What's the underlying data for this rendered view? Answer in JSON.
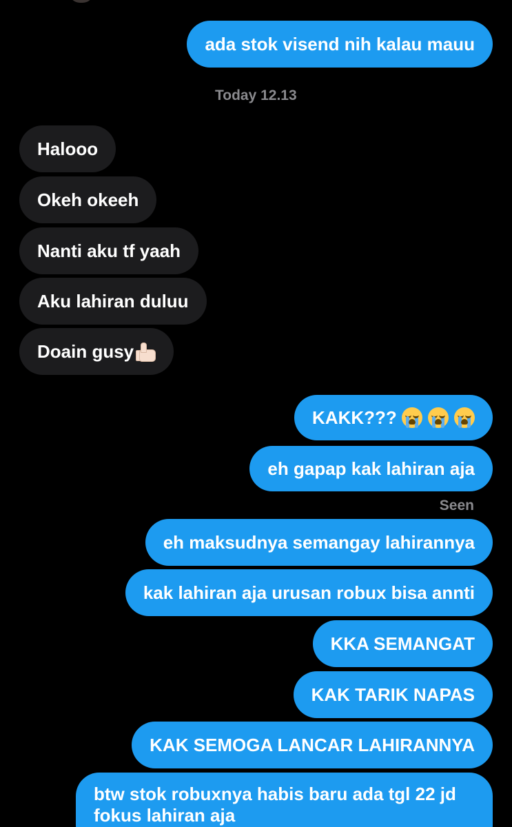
{
  "timestamp": "Today 12.13",
  "seen_label": "Seen",
  "messages": [
    {
      "text": "ada stok visend nih kalau mauu"
    },
    {
      "text": "Halooo"
    },
    {
      "text": "Okeh okeeh"
    },
    {
      "text": "Nanti aku tf yaah"
    },
    {
      "text": "Aku lahiran duluu"
    },
    {
      "text": "Doain gusy",
      "emoji": "thumbs-up-emoji"
    },
    {
      "text": "KAKK??? ",
      "emoji": "loudly-crying-face-emoji"
    },
    {
      "text": "eh gapap kak lahiran aja"
    },
    {
      "text": "eh maksudnya semangay lahirannya"
    },
    {
      "text": "kak lahiran aja urusan robux bisa annti"
    },
    {
      "text": "KKA SEMANGAT"
    },
    {
      "text": "KAK TARIK NAPAS"
    },
    {
      "text": "KAK SEMOGA LANCAR LAHIRANNYA"
    },
    {
      "text": "btw stok robuxnya habis baru ada tgl 22 jd fokus lahiran aja"
    }
  ],
  "colors": {
    "background": "#000000",
    "sent_bubble": "#1d9bf0",
    "received_bubble": "#1c1c1e",
    "meta_text": "#8a8a8e"
  }
}
